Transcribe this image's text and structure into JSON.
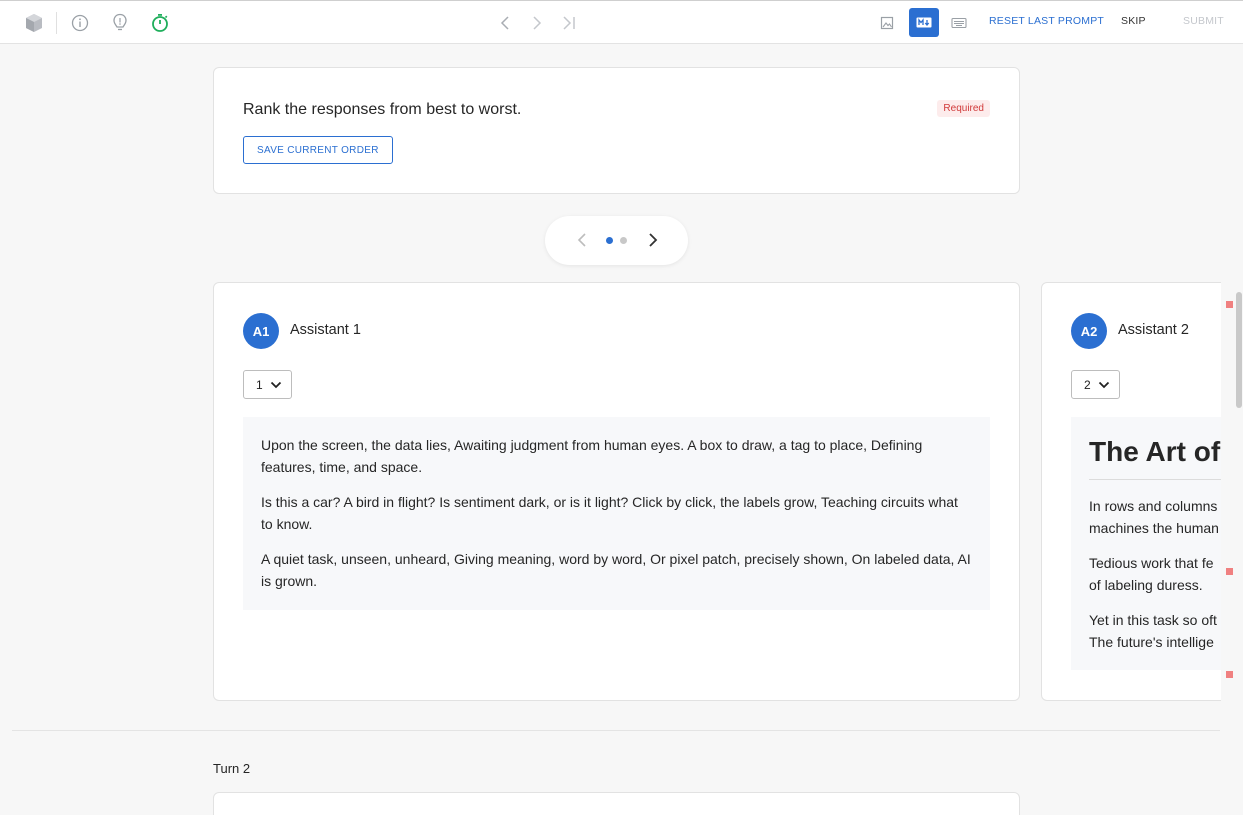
{
  "toolbar": {
    "icons": [
      "cube-icon",
      "info-icon",
      "hint-icon",
      "timer-icon"
    ],
    "reset_label": "RESET LAST PROMPT",
    "skip_label": "SKIP",
    "submit_label": "SUBMIT",
    "accent": "#2b6fd1",
    "timer_color": "#1fae5b"
  },
  "rank_card": {
    "title": "Rank the responses from best to worst.",
    "badge": "Required",
    "save_label": "SAVE CURRENT ORDER"
  },
  "pager": {
    "current_page": 1,
    "total_pages": 2
  },
  "assistants": [
    {
      "avatar": "A1",
      "name": "Assistant 1",
      "rank": "1",
      "paragraphs": [
        "Upon the screen, the data lies, Awaiting judgment from human eyes. A box to draw, a tag to place, Defining features, time, and space.",
        "Is this a car? A bird in flight? Is sentiment dark, or is it light? Click by click, the labels grow, Teaching circuits what to know.",
        "A quiet task, unseen, unheard, Giving meaning, word by word, Or pixel patch, precisely shown, On labeled data, AI is grown."
      ]
    },
    {
      "avatar": "A2",
      "name": "Assistant 2",
      "rank": "2",
      "heading": "The Art of",
      "paragraphs": [
        "In rows and columns",
        "machines the human",
        "Tedious work that fe",
        "of labeling duress.",
        "Yet in this task so oft",
        "The future's intellige"
      ]
    }
  ],
  "turn2": {
    "label": "Turn 2"
  }
}
